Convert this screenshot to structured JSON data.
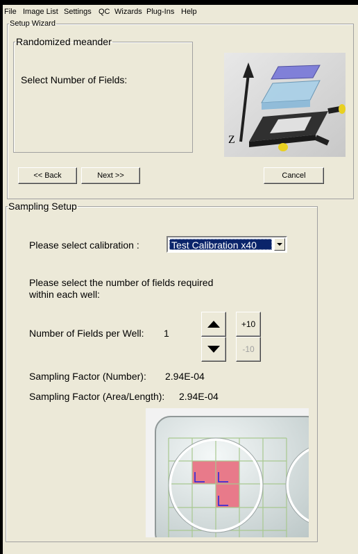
{
  "menu": [
    "File",
    "Image List",
    "Settings",
    "QC",
    "Wizards",
    "Plug-Ins",
    "Help"
  ],
  "wizard": {
    "legend": "Setup Wizard",
    "inner_legend": "Randomized meander",
    "instruction": "Select Number of Fields:",
    "back": "<< Back",
    "next": "Next >>",
    "cancel": "Cancel"
  },
  "sampling": {
    "legend": "Sampling Setup",
    "calibration_label": "Please select calibration :",
    "calibration_value": "Test Calibration x40",
    "fields_prompt_1": "Please select the number of fields required",
    "fields_prompt_2": "within each well:",
    "fields_label": "Number of Fields per Well:",
    "fields_value": "1",
    "plus10": "+10",
    "minus10": "-10",
    "factor_number_label": "Sampling Factor (Number):",
    "factor_number_value": "2.94E-04",
    "factor_area_label": "Sampling Factor (Area/Length):",
    "factor_area_value": "2.94E-04"
  },
  "icons": {
    "stage": "microscope-stage-z-axis-icon",
    "well": "well-grid-sampling-icon",
    "up": "arrow-up-icon",
    "down": "arrow-down-icon",
    "dropdown": "dropdown-arrow-icon"
  },
  "colors": {
    "window_bg": "#ece9d8",
    "selection": "#0a246a",
    "sampled_field": "#e87a8a"
  }
}
